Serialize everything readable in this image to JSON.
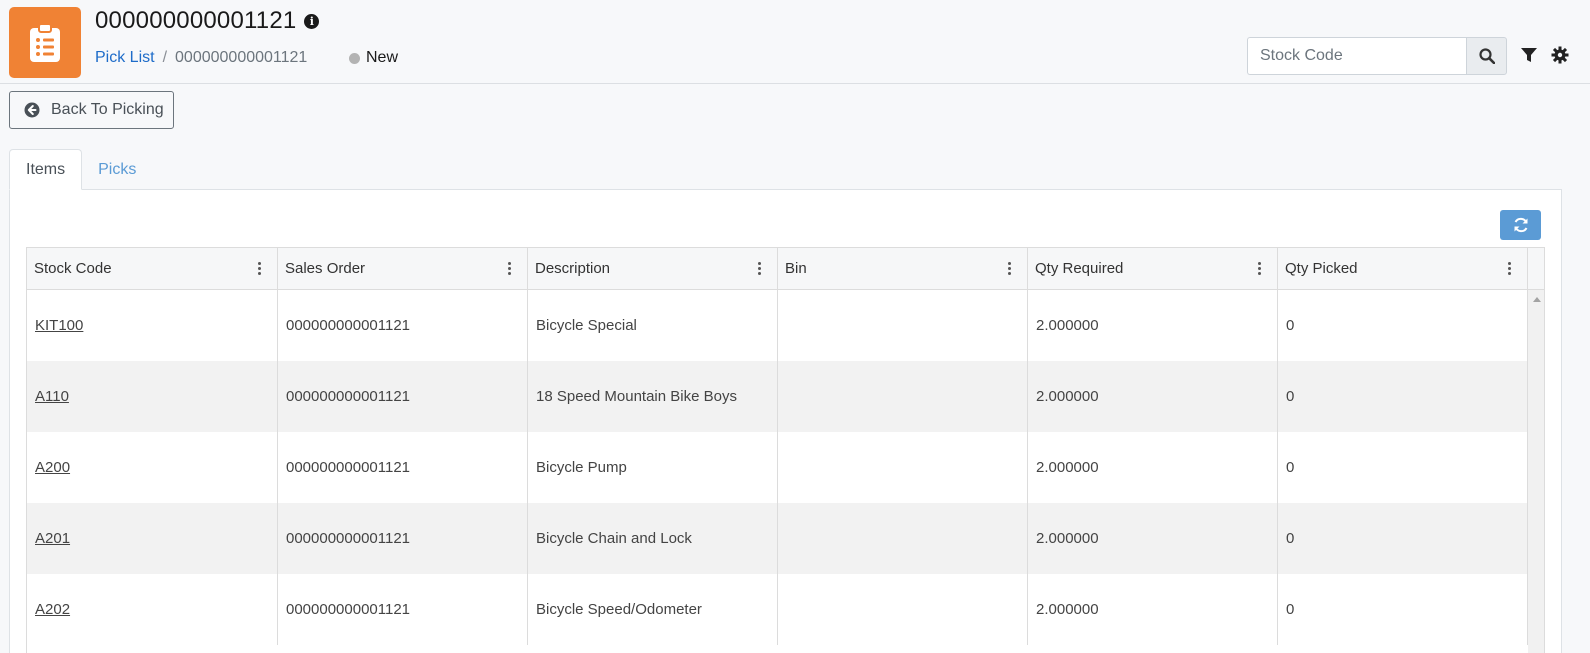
{
  "header": {
    "title": "000000000001121",
    "breadcrumb": {
      "link": "Pick List",
      "separator": "/",
      "current": "000000000001121"
    },
    "status": "New",
    "search": {
      "placeholder": "Stock Code",
      "value": ""
    },
    "icons": [
      "clipboard-list-icon",
      "info-icon",
      "search-icon",
      "filter-icon",
      "gear-icon"
    ]
  },
  "back_button": {
    "label": "Back To Picking",
    "icon": "arrow-circle-left-icon"
  },
  "tabs": [
    {
      "label": "Items",
      "active": true
    },
    {
      "label": "Picks",
      "active": false
    }
  ],
  "grid": {
    "columns": [
      "Stock Code",
      "Sales Order",
      "Description",
      "Bin",
      "Qty Required",
      "Qty Picked"
    ],
    "rows": [
      {
        "stock_code": "KIT100",
        "sales_order": "000000000001121",
        "description": "Bicycle Special",
        "bin": "",
        "qty_required": "2.000000",
        "qty_picked": "0"
      },
      {
        "stock_code": "A110",
        "sales_order": "000000000001121",
        "description": "18 Speed Mountain Bike Boys",
        "bin": "",
        "qty_required": "2.000000",
        "qty_picked": "0"
      },
      {
        "stock_code": "A200",
        "sales_order": "000000000001121",
        "description": "Bicycle Pump",
        "bin": "",
        "qty_required": "2.000000",
        "qty_picked": "0"
      },
      {
        "stock_code": "A201",
        "sales_order": "000000000001121",
        "description": "Bicycle Chain and Lock",
        "bin": "",
        "qty_required": "2.000000",
        "qty_picked": "0"
      },
      {
        "stock_code": "A202",
        "sales_order": "000000000001121",
        "description": "Bicycle Speed/Odometer",
        "bin": "",
        "qty_required": "2.000000",
        "qty_picked": "0"
      }
    ]
  },
  "colors": {
    "accent_orange": "#f08234",
    "link_blue": "#1e6cc9",
    "refresh_blue": "#5b9bd5",
    "status_gray": "#b3b3b3"
  }
}
